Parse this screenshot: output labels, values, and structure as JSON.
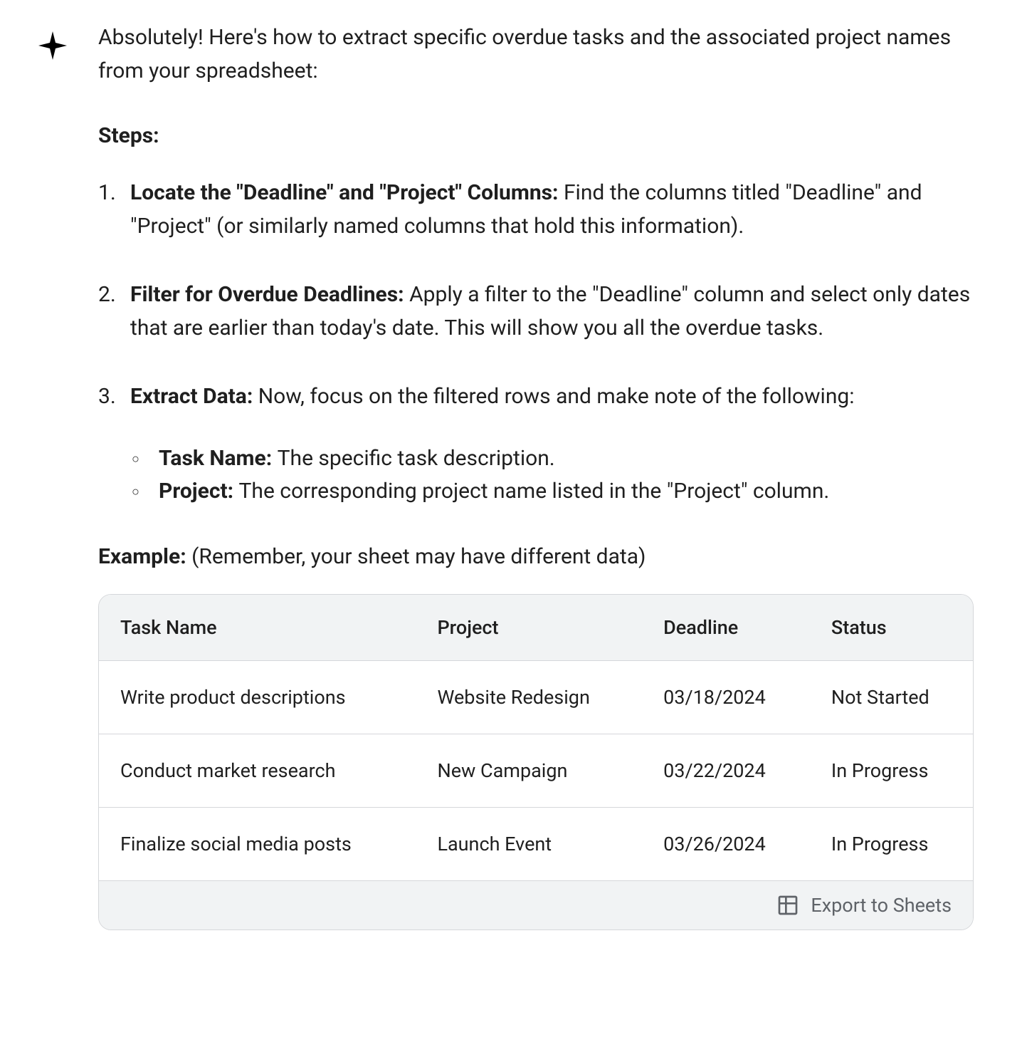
{
  "intro": "Absolutely! Here's how to extract specific overdue tasks and the associated project names from your spreadsheet:",
  "steps_heading": "Steps:",
  "steps": [
    {
      "title": "Locate the \"Deadline\" and \"Project\" Columns: ",
      "body": "Find the columns titled \"Deadline\" and \"Project\" (or similarly named columns that hold this information)."
    },
    {
      "title": "Filter for Overdue Deadlines: ",
      "body": "Apply a filter to the \"Deadline\" column and select only dates that are earlier than today's date. This will show you all the overdue tasks."
    },
    {
      "title": "Extract Data: ",
      "body": "Now, focus on the filtered rows and make note of the following:",
      "subitems": [
        {
          "title": "Task Name: ",
          "body": "The specific task description."
        },
        {
          "title": "Project: ",
          "body": "The corresponding project name listed in the \"Project\" column."
        }
      ]
    }
  ],
  "example_label": "Example:  ",
  "example_note": "(Remember, your sheet may have different data)",
  "table": {
    "headers": [
      "Task Name",
      "Project",
      "Deadline",
      "Status"
    ],
    "rows": [
      [
        "Write product descriptions",
        "Website Redesign",
        "03/18/2024",
        "Not Started"
      ],
      [
        "Conduct market research",
        "New Campaign",
        "03/22/2024",
        "In Progress"
      ],
      [
        "Finalize social media posts",
        "Launch Event",
        "03/26/2024",
        "In Progress"
      ]
    ],
    "export_label": "Export to Sheets"
  }
}
